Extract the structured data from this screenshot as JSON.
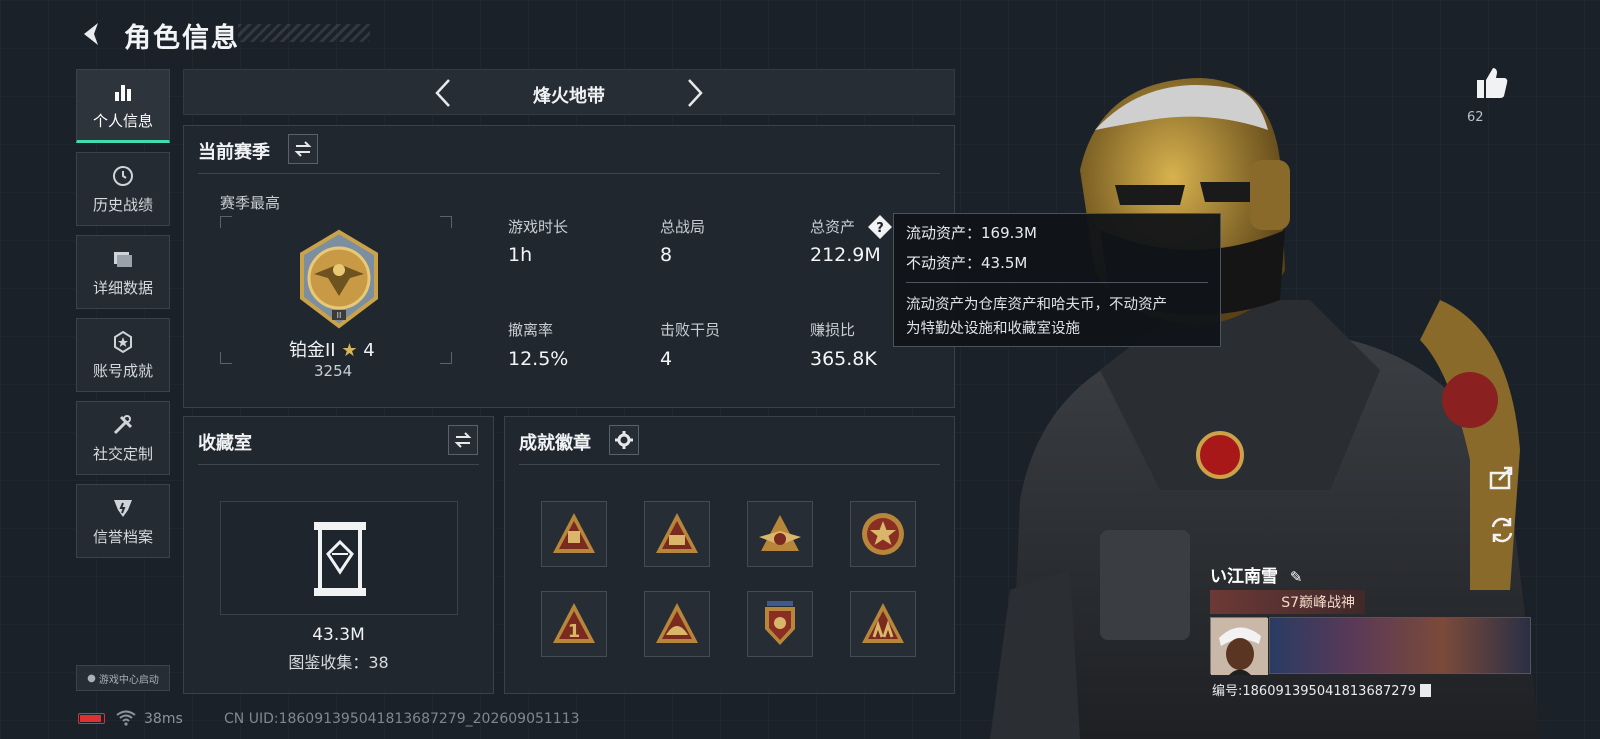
{
  "header": {
    "title": "角色信息",
    "back_icon": "back-arrow-icon"
  },
  "sidebar": {
    "items": [
      {
        "label": "个人信息",
        "icon": "bar-chart-icon",
        "active": true
      },
      {
        "label": "历史战绩",
        "icon": "clock-icon",
        "active": false
      },
      {
        "label": "详细数据",
        "icon": "folder-icon",
        "active": false
      },
      {
        "label": "账号成就",
        "icon": "star-badge-icon",
        "active": false
      },
      {
        "label": "社交定制",
        "icon": "wrench-icon",
        "active": false
      },
      {
        "label": "信誉档案",
        "icon": "shield-badge-icon",
        "active": false
      }
    ],
    "game_center": "游戏中心启动"
  },
  "mode": {
    "name": "烽火地带"
  },
  "season": {
    "title": "当前赛季",
    "best_label": "赛季最高",
    "rank_name": "铂金II",
    "rank_stars": "4",
    "rank_points": "3254",
    "stats": [
      {
        "label": "游戏时长",
        "value": "1h"
      },
      {
        "label": "总战局",
        "value": "8"
      },
      {
        "label": "总资产",
        "value": "212.9M"
      },
      {
        "label": "撤离率",
        "value": "12.5%"
      },
      {
        "label": "击败干员",
        "value": "4"
      },
      {
        "label": "赚损比",
        "value": "365.8K"
      }
    ]
  },
  "tooltip": {
    "liquid": "流动资产：169.3M",
    "fixed": "不动资产：43.5M",
    "desc_line1": "流动资产为仓库资产和哈夫币，不动资产",
    "desc_line2": "为特勤处设施和收藏室设施"
  },
  "collection": {
    "title": "收藏室",
    "value": "43.3M",
    "catalog": "图鉴收集：38"
  },
  "achievements": {
    "title": "成就徽章",
    "badges": [
      "trophy-badge-icon",
      "58-badge-icon",
      "winged-badge-icon",
      "star-medal-icon",
      "number-one-badge-icon",
      "helmet-badge-icon",
      "eagle-shield-badge-icon",
      "soldiers-badge-icon"
    ]
  },
  "right_panel": {
    "likes": "62",
    "player_name": "い江南雪",
    "player_title": "S7巅峰战神",
    "card_id": "编号:18609139504181368727​9"
  },
  "footer": {
    "ping": "38ms",
    "uid": "CN UID:18609139504181368727​9_202609051113"
  },
  "colors": {
    "accent": "#3fdcb0",
    "gold": "#c9a24a",
    "tooltip_bg": "#101317",
    "battery": "#e03030"
  }
}
